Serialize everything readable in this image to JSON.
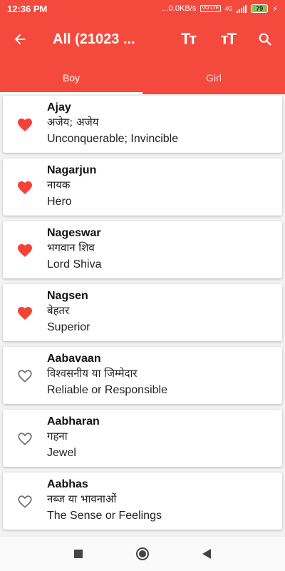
{
  "status": {
    "time": "12:36 PM",
    "net_speed": "...0.0KB/s",
    "volte": "VO LTE",
    "network": "4G",
    "battery": "79"
  },
  "appbar": {
    "title": "All (21023 ...",
    "back_icon": "back-arrow-icon",
    "text_size_icon_1": "Tт",
    "text_size_icon_2": "тT",
    "search_icon": "search-icon"
  },
  "tabs": [
    {
      "label": "Boy",
      "active": true
    },
    {
      "label": "Girl",
      "active": false
    }
  ],
  "names": [
    {
      "name": "Ajay",
      "hindi": "अजेय; अजेय",
      "meaning": "Unconquerable; Invincible",
      "favorite": true
    },
    {
      "name": "Nagarjun",
      "hindi": "नायक",
      "meaning": "Hero",
      "favorite": true
    },
    {
      "name": "Nageswar",
      "hindi": "भगवान शिव",
      "meaning": "Lord Shiva",
      "favorite": true
    },
    {
      "name": "Nagsen",
      "hindi": "बेहतर",
      "meaning": "Superior",
      "favorite": true
    },
    {
      "name": "Aabavaan",
      "hindi": "विश्वसनीय या जिम्मेदार",
      "meaning": "Reliable or Responsible",
      "favorite": false
    },
    {
      "name": "Aabharan",
      "hindi": "गहना",
      "meaning": "Jewel",
      "favorite": false
    },
    {
      "name": "Aabhas",
      "hindi": "नब्ज या भावनाओं",
      "meaning": "The Sense or Feelings",
      "favorite": false
    }
  ],
  "colors": {
    "accent": "#f44a3e",
    "heart": "#f44336",
    "heart_outline": "#757575"
  }
}
